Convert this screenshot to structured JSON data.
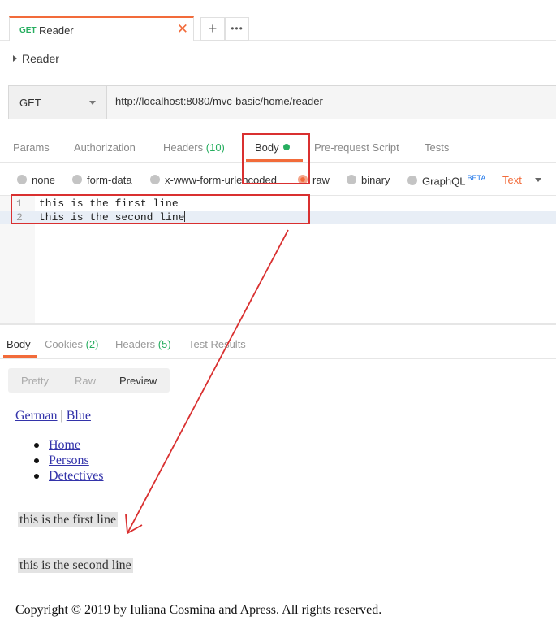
{
  "tabstrip": {
    "tab": {
      "method": "GET",
      "name": "Reader",
      "close": "✕"
    },
    "add": "+",
    "more": "•••"
  },
  "breadcrumb": {
    "name": "Reader"
  },
  "urlbar": {
    "method": "GET",
    "url": "http://localhost:8080/mvc-basic/home/reader"
  },
  "request_tabs": [
    {
      "label": "Params"
    },
    {
      "label": "Authorization"
    },
    {
      "label": "Headers",
      "count": "(10)"
    },
    {
      "label": "Body"
    },
    {
      "label": "Pre-request Script"
    },
    {
      "label": "Tests"
    }
  ],
  "body_types": [
    {
      "label": "none"
    },
    {
      "label": "form-data"
    },
    {
      "label": "x-www-form-urlencoded"
    },
    {
      "label": "raw"
    },
    {
      "label": "binary"
    },
    {
      "label": "GraphQL",
      "badge": "BETA"
    }
  ],
  "body_format": "Text",
  "editor": {
    "lines": [
      {
        "num": "1",
        "text": "this is the first line"
      },
      {
        "num": "2",
        "text": "this is the second line"
      }
    ]
  },
  "response_tabs": [
    {
      "label": "Body"
    },
    {
      "label": "Cookies",
      "count": "(2)"
    },
    {
      "label": "Headers",
      "count": "(5)"
    },
    {
      "label": "Test Results"
    }
  ],
  "view_modes": [
    "Pretty",
    "Raw",
    "Preview"
  ],
  "preview": {
    "lang_link": "German",
    "separator": "|",
    "theme_link": "Blue",
    "nav": [
      "Home",
      "Persons",
      "Detectives"
    ],
    "para1": "this is the first line",
    "para2": "this is the second line",
    "copyright": "Copyright © 2019 by Iuliana Cosmina and Apress. All rights reserved."
  },
  "colors": {
    "accent": "#f26b3a",
    "success": "#27ae60",
    "annotation": "#d93030"
  }
}
